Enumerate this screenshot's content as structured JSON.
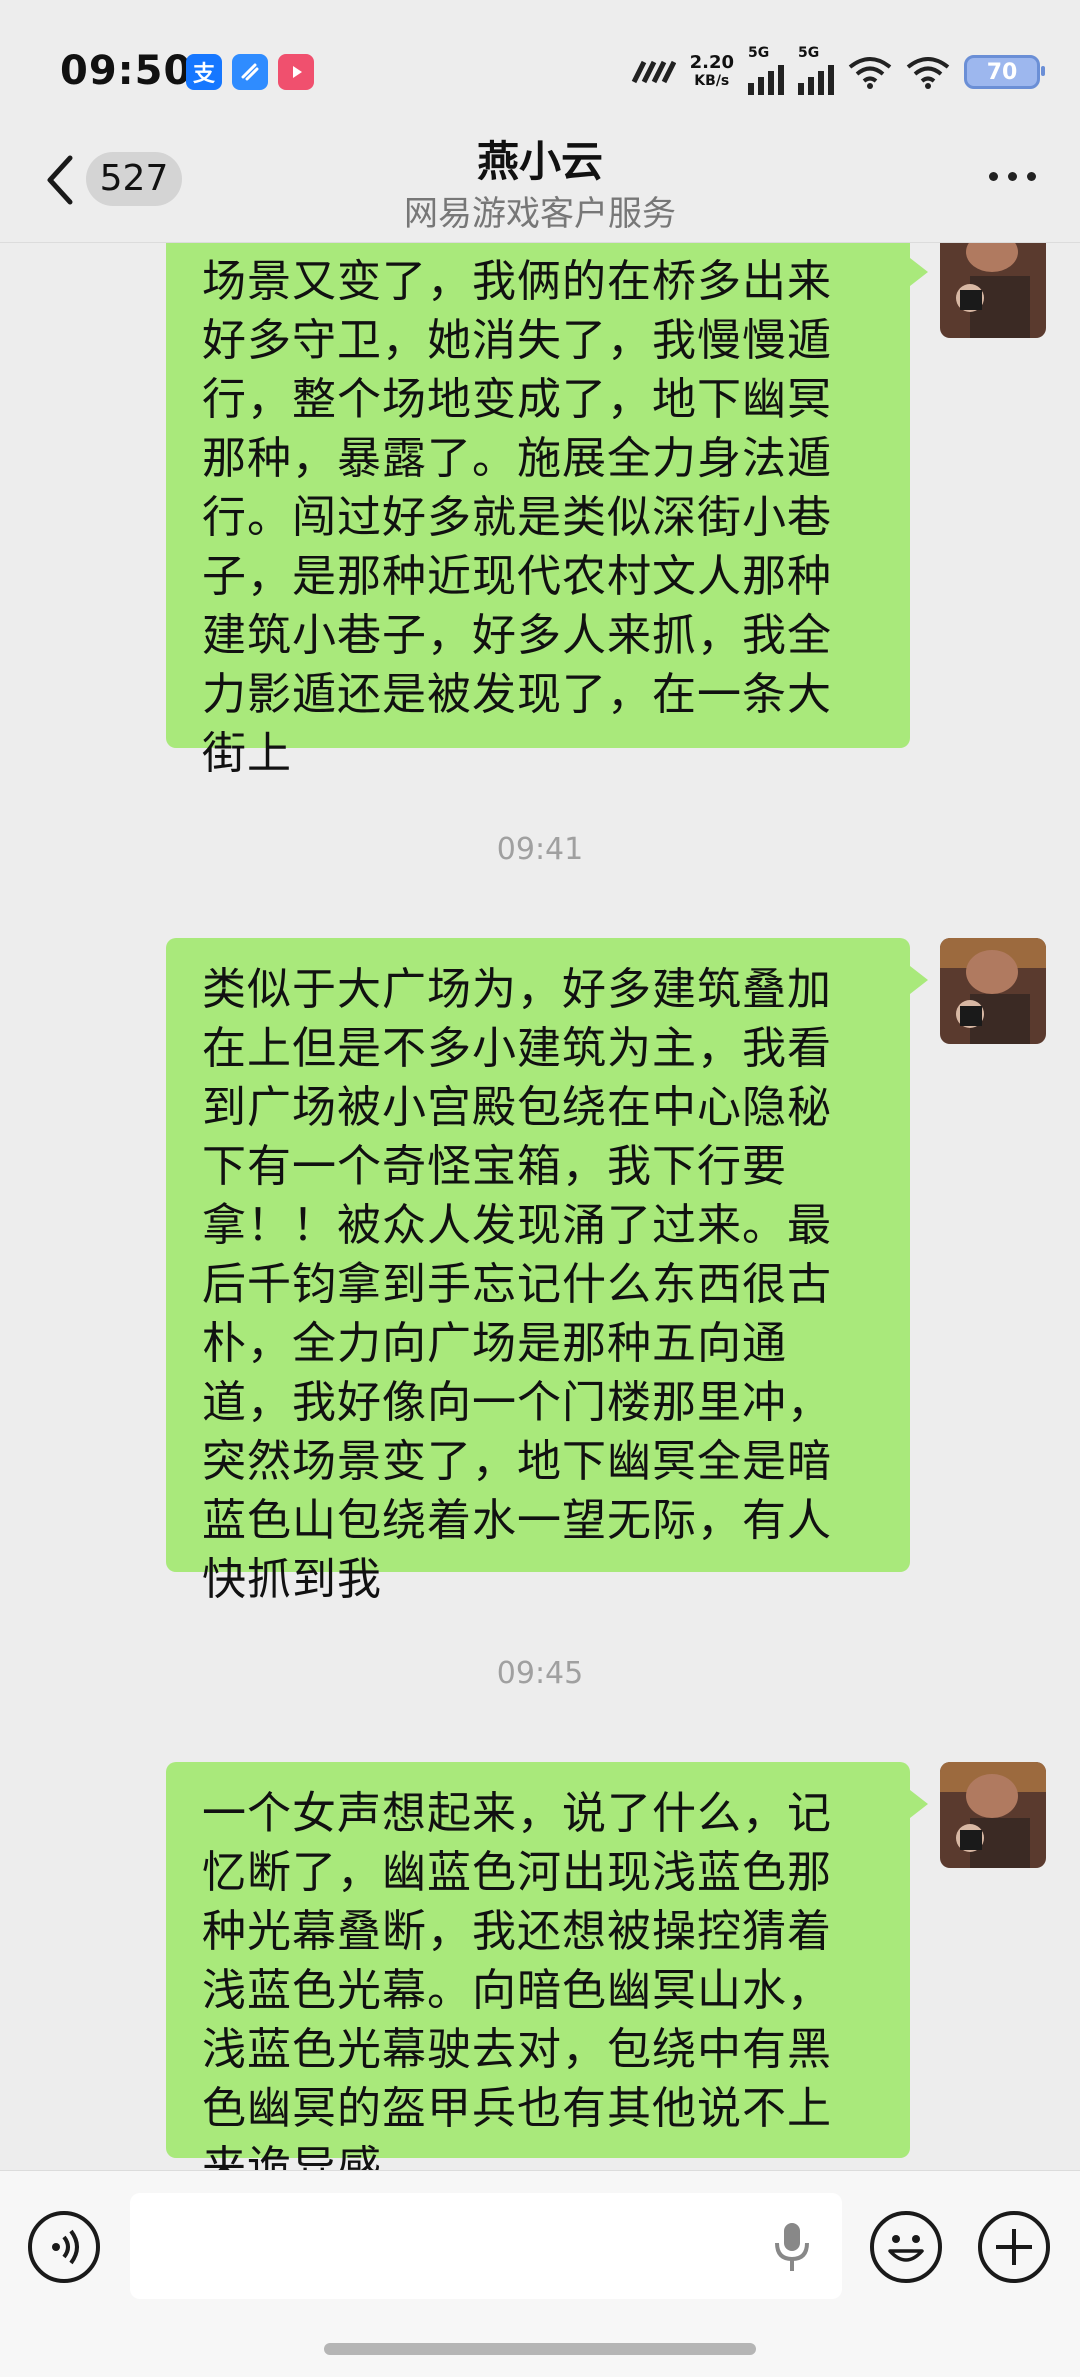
{
  "status_bar": {
    "time": "09:50",
    "app_icons": [
      "alipay-icon",
      "cloud-icon",
      "video-icon"
    ],
    "network_speed_value": "2.20",
    "network_speed_unit": "KB/s",
    "sim1_label": "5G",
    "sim2_label": "5G",
    "battery": "70"
  },
  "header": {
    "unread_count": "527",
    "title": "燕小云",
    "subtitle": "网易游戏客户服务"
  },
  "messages": [
    {
      "type": "text",
      "from": "me",
      "text": "场景又变了，我俩的在桥多出来好多守卫，她消失了，我慢慢遁行，整个场地变成了，地下幽冥那种，暴露了。施展全力身法遁行。闯过好多就是类似深街小巷子，是那种近现代农村文人那种建筑小巷子，好多人来抓，我全力影遁还是被发现了，在一条大街上"
    },
    {
      "type": "timestamp",
      "text": "09:41"
    },
    {
      "type": "text",
      "from": "me",
      "text": "类似于大广场为，好多建筑叠加在上但是不多小建筑为主，我看到广场被小宫殿包绕在中心隐秘下有一个奇怪宝箱，我下行要拿！！被众人发现涌了过来。最后千钧拿到手忘记什么东西很古朴，全力向广场是那种五向通道，我好像向一个门楼那里冲，突然场景变了，地下幽冥全是暗蓝色山包绕着水一望无际，有人快抓到我"
    },
    {
      "type": "timestamp",
      "text": "09:45"
    },
    {
      "type": "text",
      "from": "me",
      "text": "一个女声想起来，说了什么，记忆断了，幽蓝色河出现浅蓝色那种光幕叠断，我还想被操控猜着浅蓝色光幕。向暗色幽冥山水，浅蓝色光幕驶去对，包绕中有黑色幽冥的盔甲兵也有其他说不上来诡异感。"
    }
  ],
  "input_bar": {
    "voice_icon": "voice-icon",
    "mic_icon": "microphone-icon",
    "emoji_icon": "emoji-icon",
    "plus_icon": "plus-icon",
    "input_value": ""
  },
  "colors": {
    "background": "#ededed",
    "bubble_self": "#a9e97b",
    "timestamp": "#a0a0a0"
  }
}
